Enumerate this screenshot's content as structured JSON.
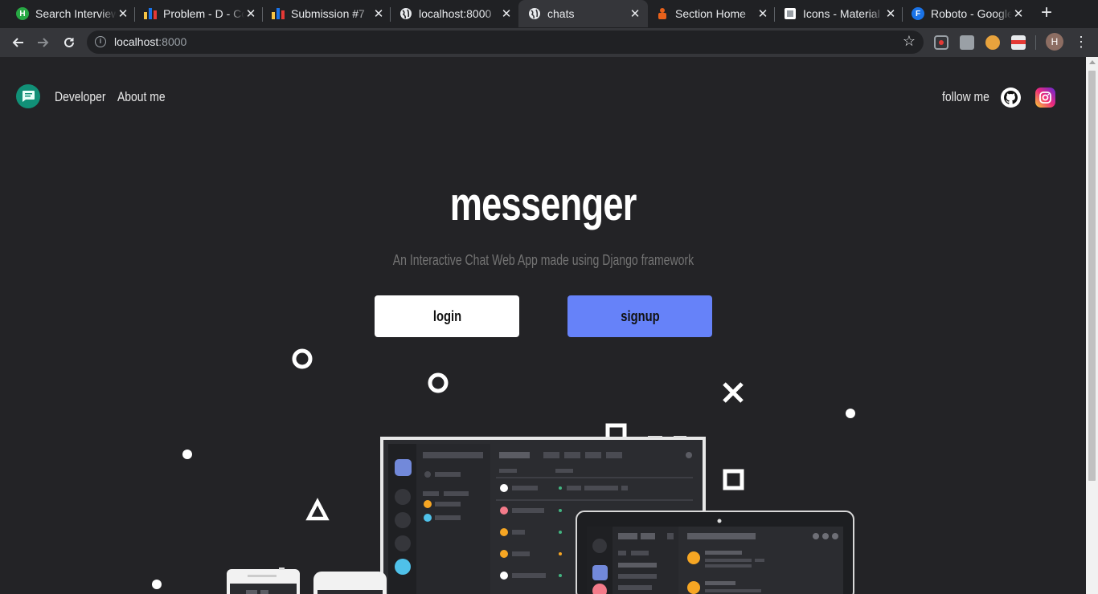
{
  "browser": {
    "tabs": [
      {
        "title": "Search Interview",
        "favicon": "hackerearth-icon",
        "color": "#27a844",
        "glyph": "H"
      },
      {
        "title": "Problem - D - Codeforces",
        "favicon": "codeforces-icon",
        "color": "#1a73e8",
        "glyph": ""
      },
      {
        "title": "Submission #7",
        "favicon": "codeforces-icon",
        "color": "#1a73e8",
        "glyph": ""
      },
      {
        "title": "localhost:8000",
        "favicon": "globe-icon",
        "color": "#e8eaed",
        "glyph": ""
      },
      {
        "title": "chats",
        "favicon": "globe-icon",
        "color": "#e8eaed",
        "glyph": ""
      },
      {
        "title": "Section Home",
        "favicon": "section-icon",
        "color": "#e8611b",
        "glyph": ""
      },
      {
        "title": "Icons - Material",
        "favicon": "material-icon",
        "color": "#ffffff",
        "glyph": ""
      },
      {
        "title": "Roboto - Google Fonts",
        "favicon": "google-fonts-icon",
        "color": "#1a73e8",
        "glyph": "F"
      }
    ],
    "active_tab": 4,
    "url_host": "localhost",
    "url_port": ":8000",
    "profile_initial": "H"
  },
  "page": {
    "nav": {
      "developer": "Developer",
      "about": "About me",
      "follow": "follow me"
    },
    "hero": {
      "title": "messenger",
      "subtitle": "An Interactive Chat Web App made using Django framework"
    },
    "buttons": {
      "login": "login",
      "signup": "signup"
    },
    "colors": {
      "background": "#232326",
      "accent": "#6682f9",
      "logo": "#119077"
    }
  }
}
